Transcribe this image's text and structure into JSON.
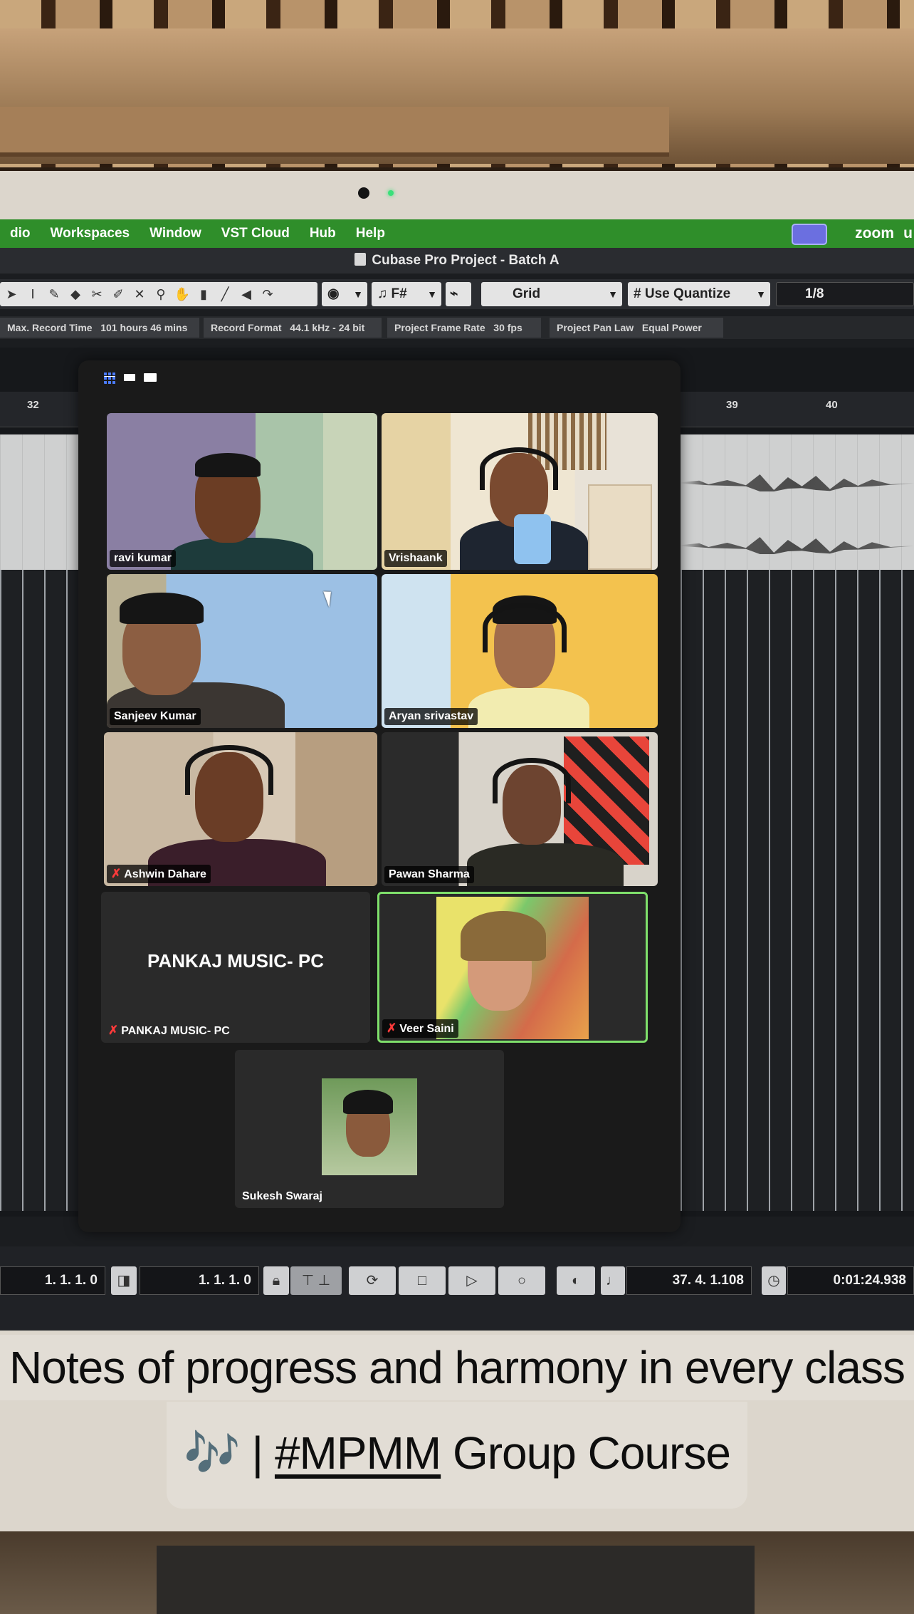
{
  "menubar": {
    "items": [
      "dio",
      "Workspaces",
      "Window",
      "VST Cloud",
      "Hub",
      "Help"
    ],
    "app_label": "zoom",
    "trailing": "u"
  },
  "window": {
    "title": "Cubase Pro Project - Batch A"
  },
  "toolbar": {
    "key_select": "F#",
    "snap_type": "Grid",
    "quantize_mode": "Use Quantize",
    "quantize_value": "1/8"
  },
  "infobar": {
    "max_record_time_label": "Max. Record Time",
    "max_record_time_value": "101 hours 46 mins",
    "record_format_label": "Record Format",
    "record_format_value": "44.1 kHz - 24 bit",
    "frame_rate_label": "Project Frame Rate",
    "frame_rate_value": "30 fps",
    "pan_law_label": "Project Pan Law",
    "pan_law_value": "Equal Power"
  },
  "ruler": {
    "left_bar": "32",
    "bar_39": "39",
    "bar_40": "40"
  },
  "zoom_meeting": {
    "participants": [
      {
        "name": "ravi kumar",
        "muted": false
      },
      {
        "name": "Vrishaank",
        "muted": false
      },
      {
        "name": "Sanjeev Kumar",
        "muted": false
      },
      {
        "name": "Aryan srivastav",
        "muted": false
      },
      {
        "name": "Ashwin Dahare",
        "muted": true
      },
      {
        "name": "Pawan Sharma",
        "muted": false
      },
      {
        "name": "PANKAJ MUSIC- PC",
        "muted": true,
        "video_off": true
      },
      {
        "name": "Veer Saini",
        "muted": true,
        "active_speaker": true
      },
      {
        "name": "Sukesh Swaraj",
        "muted": false
      }
    ],
    "camera_off_display": "PANKAJ MUSIC- PC"
  },
  "transport": {
    "left_locator": "1. 1. 1.   0",
    "right_locator": "1. 1. 1.   0",
    "position_bars": "37. 4. 1.108",
    "position_time": "0:01:24.938"
  },
  "caption": {
    "line1": "Notes of progress and harmony in every class",
    "line2_emoji": "🎶",
    "line2_separator": "|",
    "line2_tag": "#MPMM",
    "line2_rest": "Group Course"
  },
  "colors": {
    "menubar": "#2f8e2a",
    "zoom_badge": "#6b6fe0",
    "active_speaker_border": "#7fe06b",
    "mute_red": "#ff3a3a"
  }
}
